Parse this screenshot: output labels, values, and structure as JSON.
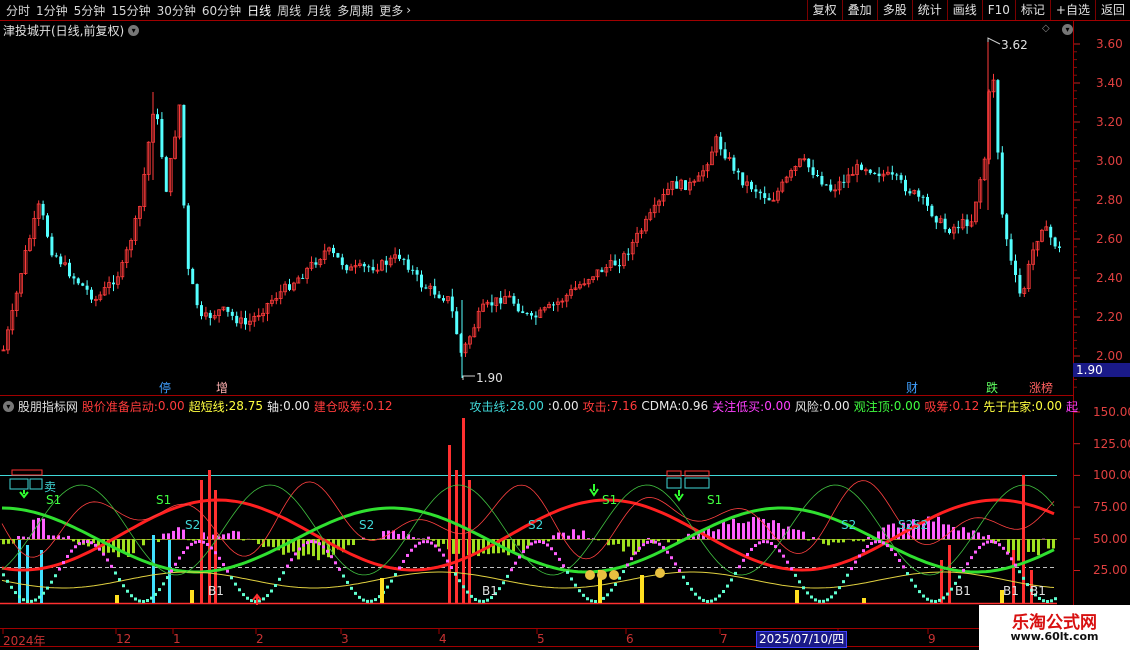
{
  "toolbar": {
    "periods": [
      "分时",
      "1分钟",
      "5分钟",
      "15分钟",
      "30分钟",
      "60分钟",
      "日线",
      "周线",
      "月线",
      "多周期",
      "更多"
    ],
    "actions": [
      "复权",
      "叠加",
      "多股",
      "统计",
      "画线",
      "F10",
      "标记",
      "+自选",
      "返回"
    ]
  },
  "stock": {
    "title": "津投城开(日线,前复权)"
  },
  "price_axis": [
    "3.60",
    "3.40",
    "3.20",
    "3.00",
    "2.80",
    "2.60",
    "2.40",
    "2.20",
    "2.00"
  ],
  "current_price": "1.90",
  "annotations": {
    "high": "3.62",
    "low": "1.90"
  },
  "events": [
    {
      "text": "停",
      "color": "#40a0ff"
    },
    {
      "text": "增",
      "color": "#ffb0b0"
    },
    {
      "text": "财",
      "color": "#40a0ff"
    },
    {
      "text": "跌",
      "color": "#60ff60"
    },
    {
      "text": "涨榜",
      "color": "#ff6060"
    }
  ],
  "indicator": {
    "name": "股朋指标网",
    "items": [
      {
        "label": "股价准备启动:",
        "value": "0.00",
        "color": "#ff3b3b"
      },
      {
        "label": "超短线:",
        "value": "28.75",
        "color": "#ffff40"
      },
      {
        "label": "轴:",
        "value": "0.00",
        "color": "#e8e8e8"
      },
      {
        "label": "建仓吸筹:",
        "value": "0.12",
        "color": "#ff3b3b"
      }
    ],
    "items2": [
      {
        "label": "攻击线:",
        "value": "28.00",
        "color": "#40d8d8"
      },
      {
        "label": ":",
        "value": "0.00",
        "color": "#e8e8e8"
      },
      {
        "label": "攻击:",
        "value": "7.16",
        "color": "#ff3b3b"
      },
      {
        "label": "CDMA:",
        "value": "0.96",
        "color": "#e8e8e8"
      },
      {
        "label": "关注低买:",
        "value": "0.00",
        "color": "#ff40ff"
      },
      {
        "label": "风险:",
        "value": "0.00",
        "color": "#e8e8e8"
      },
      {
        "label": "观注顶:",
        "value": "0.00",
        "color": "#40ff40"
      },
      {
        "label": "吸筹:",
        "value": "0.12",
        "color": "#ff3b3b"
      },
      {
        "label": "先于庄家:",
        "value": "0.00",
        "color": "#ffff40"
      },
      {
        "label": "起",
        "value": "",
        "color": "#ff40ff"
      }
    ],
    "axis": [
      "150.00",
      "125.00",
      "100.00",
      "75.00",
      "50.00",
      "25.00"
    ]
  },
  "signals": [
    "B1",
    "B1",
    "B1",
    "B1",
    "B1",
    "S1",
    "S1",
    "S1",
    "S2",
    "S2",
    "S2",
    "S2",
    "S2",
    "S2",
    "卖"
  ],
  "dates": [
    "2024年",
    "12",
    "1",
    "2",
    "3",
    "4",
    "5",
    "6",
    "7",
    "8",
    "9"
  ],
  "selected_date": "2025/07/10/四",
  "watermark": {
    "title": "乐淘公式网",
    "url": "www.60lt.com"
  },
  "colors": {
    "up": "#ff3b3b",
    "down": "#54ffff",
    "frame": "#a00000"
  }
}
